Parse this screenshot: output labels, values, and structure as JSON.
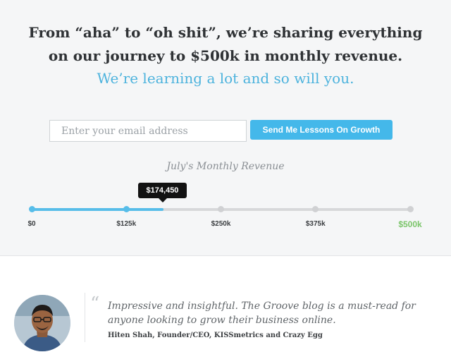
{
  "hero": {
    "headline_line1": "From “aha” to “oh shit”, we’re sharing everything",
    "headline_line2": "on our journey to $500k in monthly revenue.",
    "subhead": "We’re learning a lot and so will you."
  },
  "signup": {
    "email_placeholder": "Enter your email address",
    "button_label": "Send Me Lessons On Growth"
  },
  "revenue": {
    "title": "July's Monthly Revenue",
    "current_label": "$174,450",
    "current_value": 174450,
    "goal_value": 500000,
    "progress_fraction": 0.3489,
    "milestones": [
      "$0",
      "$125k",
      "$250k",
      "$375k",
      "$500k"
    ],
    "colors": {
      "fill": "#57bde9",
      "goal": "#7cc56b",
      "track": "#d7d8da"
    }
  },
  "testimonial": {
    "quote_line1": "Impressive and insightful. The Groove blog is a must-read for",
    "quote_line2": "anyone looking to grow their business online.",
    "author": "Hiten Shah, Founder/CEO, KISSmetrics and Crazy Egg",
    "quote_icon": "open-quote-icon",
    "avatar_icon": "person-avatar"
  },
  "brand": {
    "accent": "#44b8ea",
    "headline_color": "#2f3235"
  }
}
